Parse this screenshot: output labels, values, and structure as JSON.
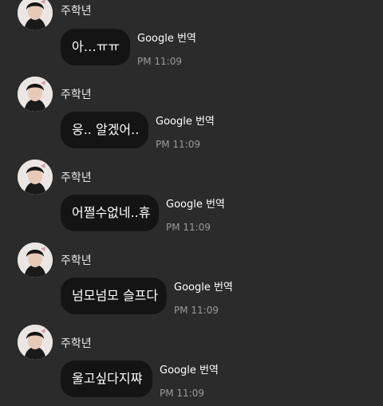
{
  "messages": [
    {
      "sender": "주학년",
      "text": "아…ㅠㅠ",
      "translate_label": "Google 번역",
      "time": "PM 11:09"
    },
    {
      "sender": "주학년",
      "text": "웅.. 알겠어..",
      "translate_label": "Google 번역",
      "time": "PM 11:09"
    },
    {
      "sender": "주학년",
      "text": "어쩔수없네..휴",
      "translate_label": "Google 번역",
      "time": "PM 11:09"
    },
    {
      "sender": "주학년",
      "text": "넘모넘모 슬프다",
      "translate_label": "Google 번역",
      "time": "PM 11:09"
    },
    {
      "sender": "주학년",
      "text": "울고싶다지쨔",
      "translate_label": "Google 번역",
      "time": "PM 11:09"
    }
  ],
  "colors": {
    "background": "#2b2b2b",
    "bubble": "#141414",
    "timestamp": "#9a9a9a"
  }
}
